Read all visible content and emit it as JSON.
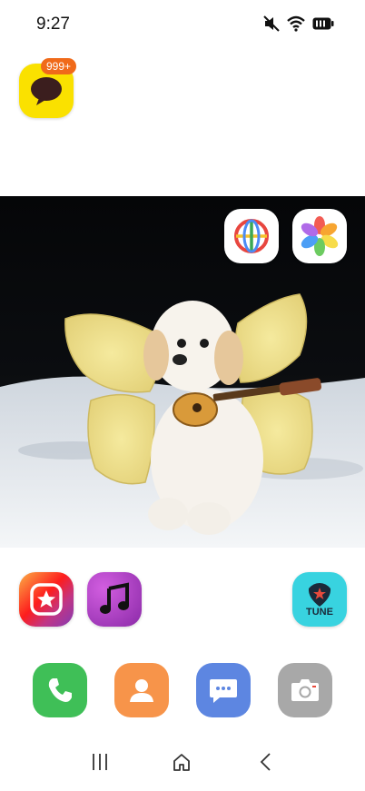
{
  "status_bar": {
    "time": "9:27",
    "icons": [
      "mute-icon",
      "wifi-icon",
      "battery-icon"
    ]
  },
  "home": {
    "messenger_badge": "999+",
    "tune_label": "TUNE"
  },
  "colors": {
    "messenger_yellow": "#fae100",
    "phone_green": "#3fbf57",
    "contacts_orange": "#f7944a",
    "messages_blue": "#5d86e1",
    "camera_gray": "#a8a8a8",
    "tune_teal": "#38d3e0",
    "badge_orange": "#f06a1a"
  },
  "icons": {
    "top_left": "chat-bubble-icon",
    "photo_widget_apps": [
      "globe-browser-icon",
      "pinwheel-gallery-icon"
    ],
    "row_apps": [
      "instagram-icon",
      "music-note-icon",
      "guitar-pick-tune-icon"
    ],
    "dock": [
      "phone-icon",
      "contacts-icon",
      "messages-icon",
      "camera-icon"
    ],
    "nav": [
      "recents-icon",
      "home-icon",
      "back-icon"
    ]
  }
}
